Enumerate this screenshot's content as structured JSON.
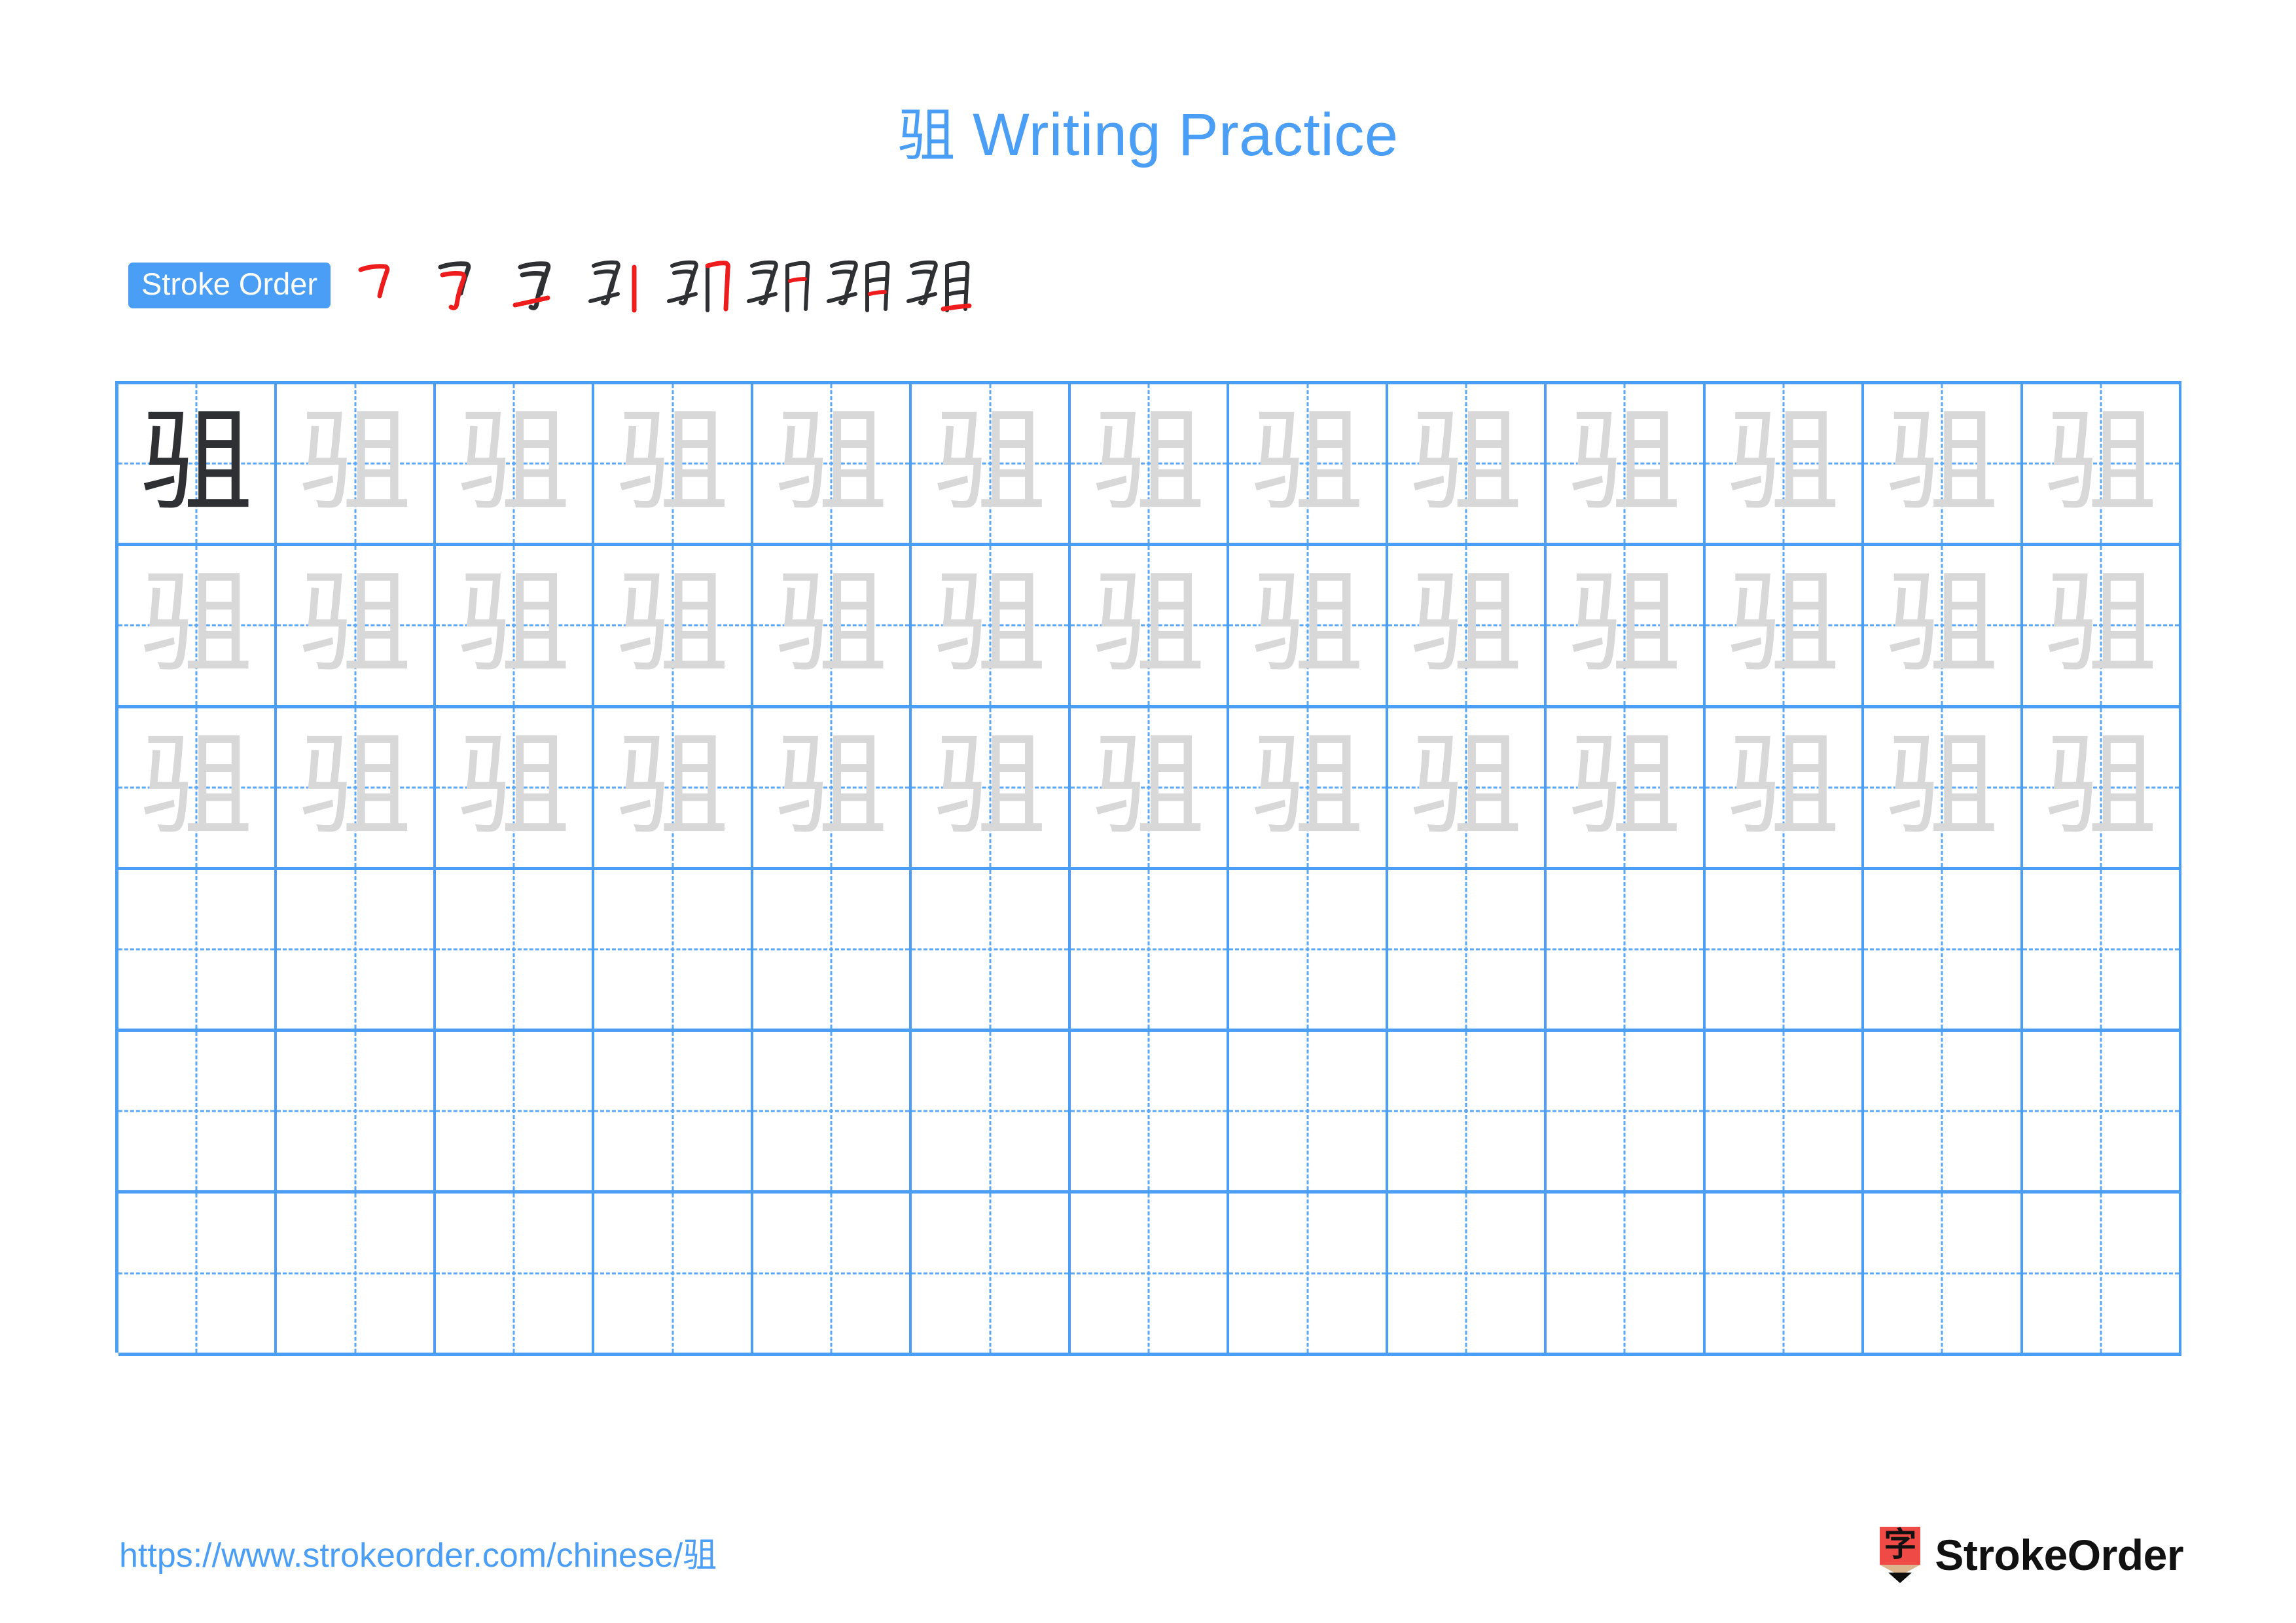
{
  "character": "驵",
  "title": {
    "character": "驵",
    "suffix": " Writing Practice",
    "full": "驵 Writing Practice",
    "color": "#4a9ef5"
  },
  "stroke_order": {
    "badge_label": "Stroke Order",
    "badge_bg": "#4a9ef5",
    "badge_text_color": "#ffffff",
    "total_strokes": 8,
    "new_stroke_color": "#ee1c1c",
    "existing_stroke_color": "#2f3033",
    "steps": [
      {
        "index": 1,
        "partial": "乛",
        "name": "stroke-step-1"
      },
      {
        "index": 2,
        "partial": "𠃍",
        "name": "stroke-step-2"
      },
      {
        "index": 3,
        "partial": "马",
        "name": "stroke-step-3"
      },
      {
        "index": 4,
        "partial": "马丨",
        "name": "stroke-step-4"
      },
      {
        "index": 5,
        "partial": "驲",
        "name": "stroke-step-5"
      },
      {
        "index": 6,
        "partial": "驲",
        "name": "stroke-step-6"
      },
      {
        "index": 7,
        "partial": "䮝",
        "name": "stroke-step-7"
      },
      {
        "index": 8,
        "partial": "驵",
        "name": "stroke-step-8"
      }
    ]
  },
  "grid": {
    "columns": 13,
    "rows": 6,
    "line_color": "#4a9ef5",
    "guide_color": "#5aa8f7",
    "model_char_color": "#2f3033",
    "trace_char_color": "#d8d8d8",
    "row_fill": [
      [
        "model",
        "trace",
        "trace",
        "trace",
        "trace",
        "trace",
        "trace",
        "trace",
        "trace",
        "trace",
        "trace",
        "trace",
        "trace"
      ],
      [
        "trace",
        "trace",
        "trace",
        "trace",
        "trace",
        "trace",
        "trace",
        "trace",
        "trace",
        "trace",
        "trace",
        "trace",
        "trace"
      ],
      [
        "trace",
        "trace",
        "trace",
        "trace",
        "trace",
        "trace",
        "trace",
        "trace",
        "trace",
        "trace",
        "trace",
        "trace",
        "trace"
      ],
      [
        "empty",
        "empty",
        "empty",
        "empty",
        "empty",
        "empty",
        "empty",
        "empty",
        "empty",
        "empty",
        "empty",
        "empty",
        "empty"
      ],
      [
        "empty",
        "empty",
        "empty",
        "empty",
        "empty",
        "empty",
        "empty",
        "empty",
        "empty",
        "empty",
        "empty",
        "empty",
        "empty"
      ],
      [
        "empty",
        "empty",
        "empty",
        "empty",
        "empty",
        "empty",
        "empty",
        "empty",
        "empty",
        "empty",
        "empty",
        "empty",
        "empty"
      ]
    ]
  },
  "footer": {
    "url": "https://www.strokeorder.com/chinese/驵",
    "url_color": "#4a9ef5",
    "logo_glyph": "字",
    "logo_bg": "#ef4a46",
    "logo_wood": "#ddb58c",
    "logo_tip": "#0d0d0d",
    "brand": "StrokeOrder",
    "brand_color": "#111111"
  }
}
